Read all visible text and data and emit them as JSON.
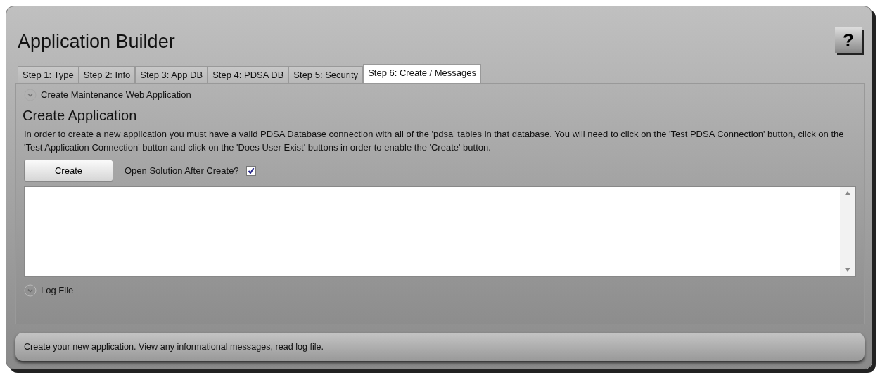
{
  "window": {
    "title": "Application Builder",
    "help_button": "?"
  },
  "tabs": [
    {
      "label": "Step 1: Type",
      "selected": false
    },
    {
      "label": "Step 2: Info",
      "selected": false
    },
    {
      "label": "Step 3: App DB",
      "selected": false
    },
    {
      "label": "Step 4: PDSA DB",
      "selected": false
    },
    {
      "label": "Step 5: Security",
      "selected": false
    },
    {
      "label": "Step 6: Create / Messages",
      "selected": true
    }
  ],
  "expanders": [
    {
      "header": "Create Maintenance Web Application",
      "expanded": true
    },
    {
      "header": "Log File",
      "expanded": false
    }
  ],
  "create_section": {
    "heading": "Create Application",
    "description": "In order to create a new application you must have a valid PDSA Database connection with all of the 'pdsa' tables in that database. You will need to click on the 'Test PDSA Connection' button, click on the 'Test Application Connection' button and click on the 'Does User Exist' buttons in order to enable the 'Create' button.",
    "create_button": "Create",
    "open_solution": {
      "label": "Open Solution After Create?",
      "checked": true
    }
  },
  "status_bar": "Create your new application. View any informational messages, read log file."
}
